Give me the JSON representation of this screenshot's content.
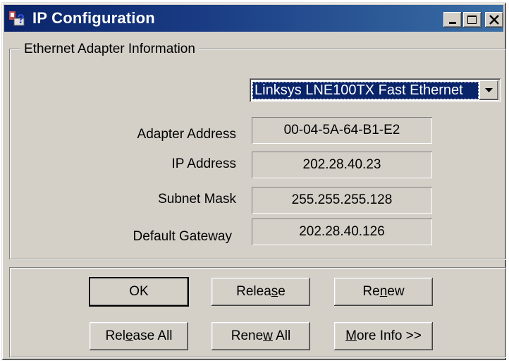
{
  "window": {
    "title": "IP Configuration"
  },
  "group": {
    "legend": "Ethernet  Adapter Information"
  },
  "adapter_dropdown": {
    "selected": "Linksys LNE100TX Fast Ethernet"
  },
  "fields": {
    "adapter_address": {
      "label": "Adapter Address",
      "value": "00-04-5A-64-B1-E2"
    },
    "ip_address": {
      "label": "IP Address",
      "value": "202.28.40.23"
    },
    "subnet_mask": {
      "label": "Subnet Mask",
      "value": "255.255.255.128"
    },
    "default_gateway": {
      "label": "Default Gateway",
      "value": "202.28.40.126"
    }
  },
  "buttons": {
    "ok": {
      "label": "OK"
    },
    "release": {
      "pre": "Relea",
      "mnemonic": "s",
      "post": "e"
    },
    "renew": {
      "pre": "Re",
      "mnemonic": "n",
      "post": "ew"
    },
    "release_all": {
      "pre": "Rel",
      "mnemonic": "e",
      "post": "ase All"
    },
    "renew_all": {
      "pre": "Rene",
      "mnemonic": "w",
      "post": " All"
    },
    "more_info": {
      "pre": "",
      "mnemonic": "M",
      "post": "ore Info >>"
    }
  },
  "icons": {
    "app": "network-question-icon",
    "minimize": "minimize-icon",
    "maximize": "maximize-icon",
    "close": "close-icon",
    "dropdown": "chevron-down-icon"
  },
  "colors": {
    "titlebar_start": "#0a246a",
    "titlebar_end": "#3a6ea5",
    "face": "#d4d0c8",
    "selection": "#0a246a"
  }
}
